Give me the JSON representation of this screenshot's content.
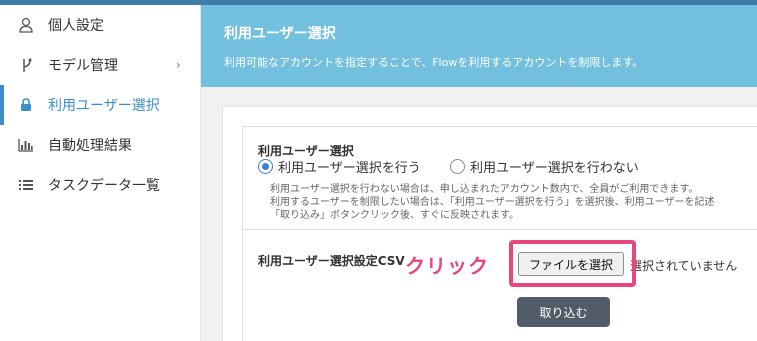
{
  "sidebar": {
    "items": [
      {
        "label": "個人設定",
        "icon": "user-icon"
      },
      {
        "label": "モデル管理",
        "icon": "fork-icon",
        "chevron": "›"
      },
      {
        "label": "利用ユーザー選択",
        "icon": "lock-icon"
      },
      {
        "label": "自動処理結果",
        "icon": "bar-chart-icon"
      },
      {
        "label": "タスクデータ一覧",
        "icon": "list-icon"
      }
    ]
  },
  "header": {
    "title": "利用ユーザー選択",
    "subtitle": "利用可能なアカウントを指定することで、Flowを利用するアカウントを制限します。"
  },
  "selection": {
    "title": "利用ユーザー選択",
    "options": [
      "利用ユーザー選択を行う",
      "利用ユーザー選択を行わない"
    ],
    "selected": "利用ユーザー選択を行う",
    "help": [
      "利用ユーザー選択を行わない場合は、申し込まれたアカウント数内で、全員がご利用できます。",
      "利用するユーザーを制限したい場合は、「利用ユーザー選択を行う」を選択後、利用ユーザーを記述",
      "「取り込み」ボタンクリック後、すぐに反映されます。"
    ]
  },
  "csv": {
    "label": "利用ユーザー選択設定CSV",
    "annotation": "クリック",
    "file_button": "ファイルを選択",
    "file_status": "選択されていません",
    "import_button": "取り込む"
  },
  "colors": {
    "accent": "#3b8ec9",
    "header": "#73bfde",
    "highlight": "#e8467d",
    "import_button": "#525c68"
  }
}
